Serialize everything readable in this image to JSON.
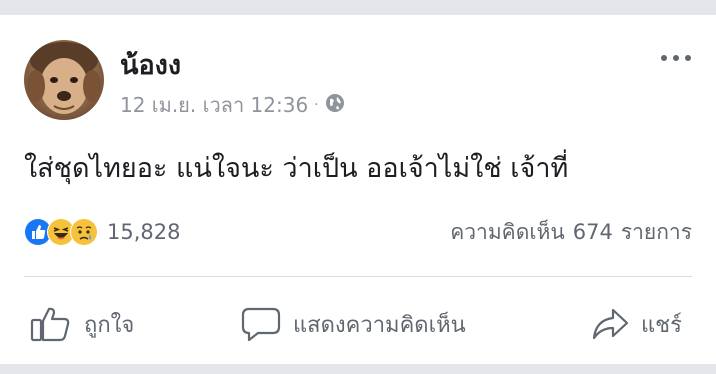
{
  "post": {
    "author": "น้องง",
    "date": "12 เม.ย. เวลา 12:36",
    "separator": "·",
    "privacy_icon": "globe-icon",
    "text": "ใส่ชุดไทยอะ แน่ใจนะ ว่าเป็น ออเจ้าไม่ใช่ เจ้าที่"
  },
  "reactions": {
    "icons": [
      "like-reaction-icon",
      "haha-reaction-icon",
      "sad-reaction-icon"
    ],
    "count": "15,828"
  },
  "comments": {
    "label": "ความคิดเห็น",
    "count": "674",
    "unit": "รายการ"
  },
  "actions": {
    "like_label": "ถูกใจ",
    "comment_label": "แสดงความคิดเห็น",
    "share_label": "แชร์"
  },
  "colors": {
    "background": "#e4e6e9",
    "card": "#ffffff",
    "primary_text": "#1c1e21",
    "secondary_text": "#606770",
    "meta_text": "#90949c",
    "like_blue": "#1877f2",
    "emoji_yellow": "#f7c23b"
  }
}
